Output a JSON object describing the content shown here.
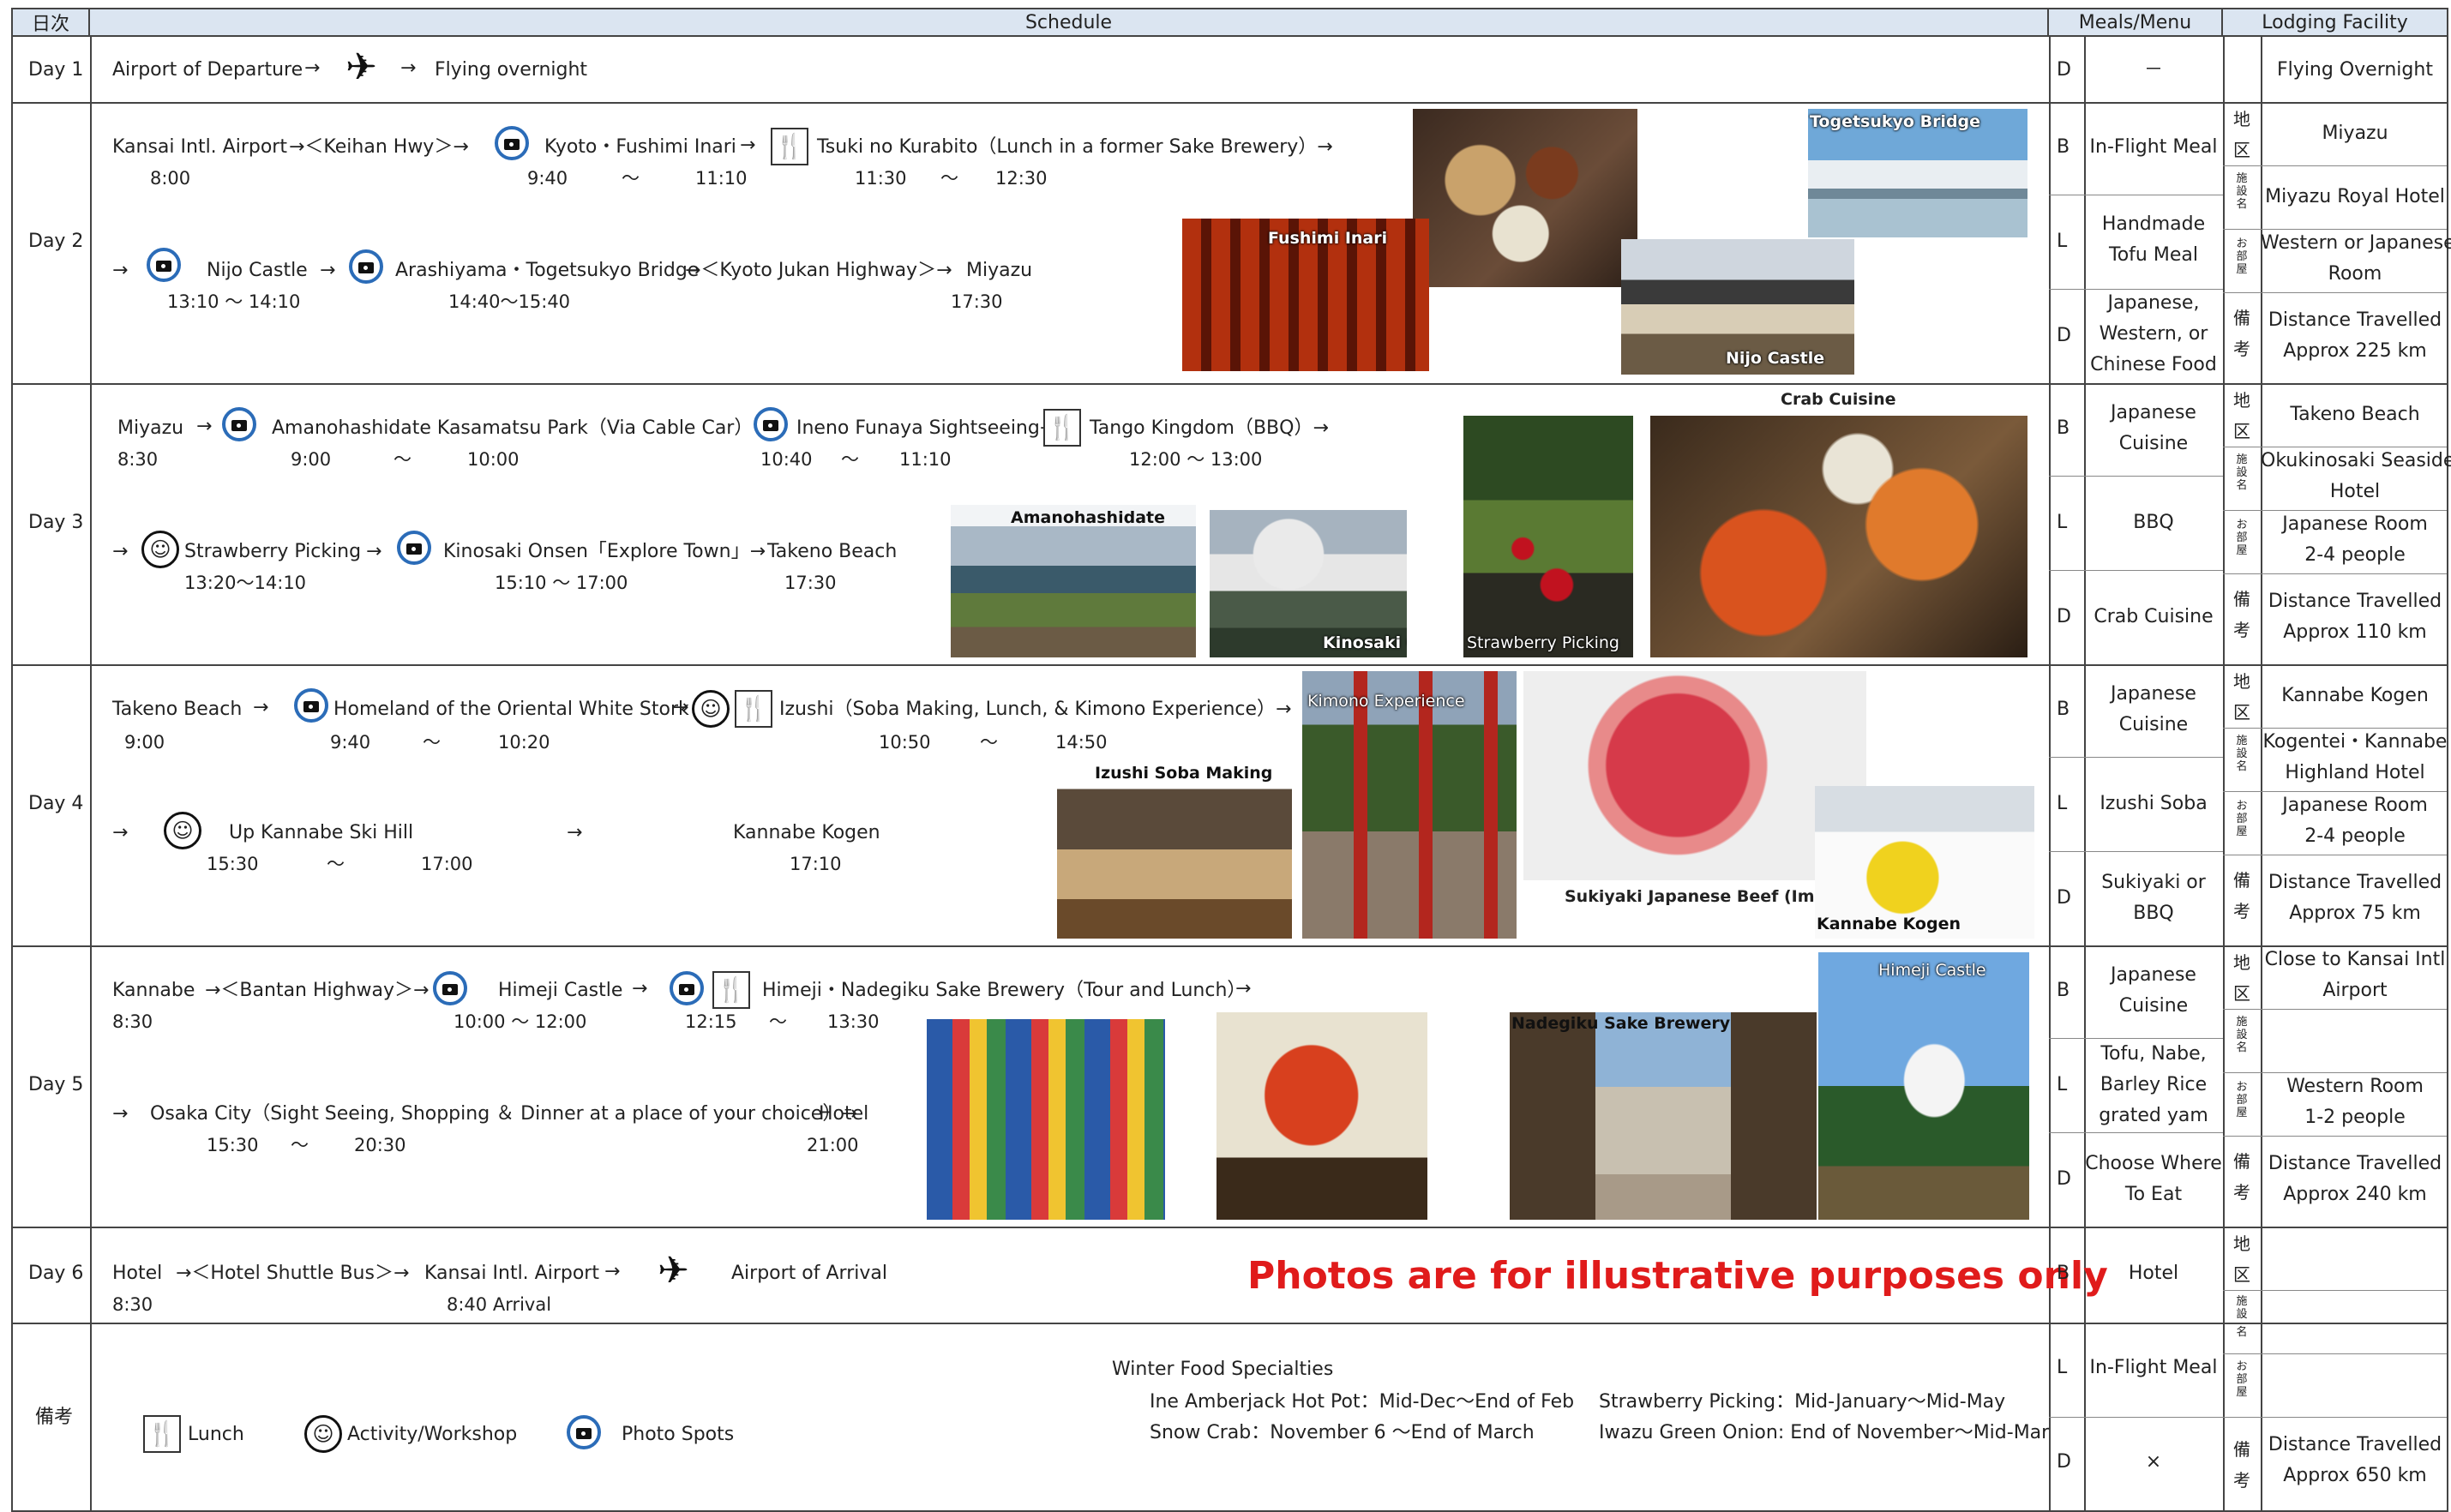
{
  "header": {
    "day": "日次",
    "schedule": "Schedule",
    "meals": "Meals/Menu",
    "lodging": "Lodging Facility"
  },
  "day1": {
    "label": "Day 1",
    "from": "Airport of Departure",
    "arrow1": "→",
    "arrow2": "→",
    "to": "Flying overnight",
    "meal_code": "D",
    "meal": "－",
    "lodging": "Flying Overnight"
  },
  "day2": {
    "label": "Day 2",
    "line1": {
      "a": "Kansai Intl. Airport",
      "b": "→＜Keihan Hwy＞→",
      "c": "Kyoto・Fushimi Inari",
      "d": "→",
      "e": "Tsuki no Kurabito（Lunch in a former Sake Brewery）→"
    },
    "times1": {
      "t1": "8:00",
      "t2": "9:40",
      "t3": "〜",
      "t4": "11:10",
      "t5": "11:30",
      "t6": "〜",
      "t7": "12:30"
    },
    "line2": {
      "a": "→",
      "b": "Nijo Castle",
      "c": "→",
      "d": "Arashiyama・Togetsukyo Bridge",
      "e": "→＜Kyoto Jukan Highway＞→",
      "f": "Miyazu"
    },
    "times2": {
      "t1": "13:10 〜 14:10",
      "t2": "14:40〜15:40",
      "t3": "17:30"
    },
    "photos": {
      "fushimi": "Fushimi Inari",
      "nijo": "Nijo Castle",
      "togetsukyo": "Togetsukyo Bridge"
    },
    "meals": [
      {
        "code": "B",
        "text": [
          "In-Flight Meal"
        ]
      },
      {
        "code": "L",
        "text": [
          "Handmade",
          "Tofu Meal"
        ]
      },
      {
        "code": "D",
        "text": [
          "Japanese,",
          "Western, or",
          "Chinese Food"
        ]
      }
    ],
    "lodging": {
      "area": "Miyazu",
      "facility": "Miyazu Royal Hotel",
      "room": [
        "Western or Japanese",
        "Room"
      ],
      "note": [
        "Distance Travelled",
        "Approx 225 km"
      ]
    }
  },
  "day3": {
    "label": "Day 3",
    "line1": {
      "a": "Miyazu",
      "b": "→",
      "c": "Amanohashidate Kasamatsu Park（Via Cable Car）→",
      "d": "Ineno Funaya Sightseeing→",
      "e": "Tango Kingdom（BBQ）→"
    },
    "times1": {
      "t1": "8:30",
      "t2": "9:00",
      "t3": "〜",
      "t4": "10:00",
      "t5": "10:40",
      "t6": "〜",
      "t7": "11:10",
      "t8": "12:00 〜 13:00"
    },
    "line2": {
      "a": "→",
      "b": "Strawberry Picking",
      "c": "→",
      "d": "Kinosaki Onsen「Explore Town」→",
      "e": "Takeno Beach"
    },
    "times2": {
      "t1": "13:20〜14:10",
      "t2": "15:10 〜 17:00",
      "t3": "17:30"
    },
    "photos": {
      "amano": "Amanohashidate",
      "kinosaki": "Kinosaki Onsen",
      "straw": "Strawberry Picking",
      "crab": "Crab Cuisine"
    },
    "meals": [
      {
        "code": "B",
        "text": [
          "Japanese",
          "Cuisine"
        ]
      },
      {
        "code": "L",
        "text": [
          "BBQ"
        ]
      },
      {
        "code": "D",
        "text": [
          "Crab Cuisine"
        ]
      }
    ],
    "lodging": {
      "area": "Takeno Beach",
      "facility": [
        "Okukinosaki Seaside",
        "Hotel"
      ],
      "room": [
        "Japanese Room",
        "2-4 people"
      ],
      "note": [
        "Distance Travelled",
        "Approx 110 km"
      ]
    }
  },
  "day4": {
    "label": "Day 4",
    "line1": {
      "a": "Takeno Beach",
      "b": "→",
      "c": "Homeland of the Oriental White Stork",
      "d": "→",
      "e": "Izushi（Soba Making, Lunch, & Kimono Experience）→"
    },
    "times1": {
      "t1": "9:00",
      "t2": "9:40",
      "t3": "〜",
      "t4": "10:20",
      "t5": "10:50",
      "t6": "〜",
      "t7": "14:50"
    },
    "line2": {
      "a": "→",
      "b": "Up Kannabe Ski Hill",
      "c": "→",
      "d": "Kannabe Kogen"
    },
    "times2": {
      "t1": "15:30",
      "t2": "〜",
      "t3": "17:00",
      "t4": "17:10"
    },
    "photos": {
      "soba": "Izushi Soba Making",
      "kimono": "Kimono Experience",
      "beef": "Sukiyaki Japanese Beef (Image)",
      "kannabe": "Kannabe Kogen"
    },
    "meals": [
      {
        "code": "B",
        "text": [
          "Japanese",
          "Cuisine"
        ]
      },
      {
        "code": "L",
        "text": [
          "Izushi Soba"
        ]
      },
      {
        "code": "D",
        "text": [
          "Sukiyaki or",
          "BBQ"
        ]
      }
    ],
    "lodging": {
      "area": "Kannabe Kogen",
      "facility": [
        "Kogentei・Kannabe",
        "Highland Hotel"
      ],
      "room": [
        "Japanese Room",
        "2-4 people"
      ],
      "note": [
        "Distance Travelled",
        "Approx 75 km"
      ]
    }
  },
  "day5": {
    "label": "Day 5",
    "line1": {
      "a": "Kannabe",
      "b": "→＜Bantan Highway＞→",
      "c": "Himeji Castle",
      "d": "→",
      "e": "Himeji・Nadegiku Sake Brewery（Tour and Lunch）",
      "f": "→"
    },
    "times1": {
      "t1": "8:30",
      "t2": "10:00 〜 12:00",
      "t3": "12:15",
      "t4": "〜",
      "t5": "13:30"
    },
    "line2": {
      "a": "→",
      "b": "Osaka City（Sight Seeing, Shopping ＆ Dinner at a place of your choice）→",
      "c": "Hotel"
    },
    "times2": {
      "t1": "15:30",
      "t2": "〜",
      "t3": "20:30",
      "t4": "21:00"
    },
    "photos": {
      "nadegiku": "Nadegiku Sake Brewery",
      "himeji": "Himeji Castle"
    },
    "meals": [
      {
        "code": "B",
        "text": [
          "Japanese",
          "Cuisine"
        ]
      },
      {
        "code": "L",
        "text": [
          "Tofu, Nabe,",
          "Barley Rice",
          "grated yam"
        ]
      },
      {
        "code": "D",
        "text": [
          "Choose Where",
          "To Eat"
        ]
      }
    ],
    "lodging": {
      "area": [
        "Close to Kansai Intl",
        "Airport"
      ],
      "facility": "",
      "room": [
        "Western Room",
        "1-2 people"
      ],
      "note": [
        "Distance Travelled",
        "Approx 240 km"
      ]
    }
  },
  "day6": {
    "label": "Day 6",
    "line1": {
      "a": "Hotel",
      "b": "→＜Hotel Shuttle Bus＞→",
      "c": "Kansai Intl. Airport",
      "d": "→",
      "e": "Airport of Arrival"
    },
    "times1": {
      "t1": "8:30",
      "t2": "8:40 Arrival"
    },
    "note": "Photos are for illustrative purposes only",
    "meals": [
      {
        "code": "B",
        "text": [
          "Hotel"
        ]
      },
      {
        "code": "L",
        "text": [
          "In-Flight Meal"
        ]
      },
      {
        "code": "D",
        "text": [
          "×"
        ]
      }
    ],
    "lodging": {
      "note": [
        "Distance Travelled",
        "Approx 650 km"
      ]
    }
  },
  "remarks": {
    "label": "備考",
    "legend": {
      "lunch": "Lunch",
      "activity": "Activity/Workshop",
      "photo": "Photo Spots"
    },
    "winter_title": "Winter Food Specialties",
    "w1": "Ine Amberjack Hot Pot：Mid-Dec〜End of Feb",
    "w2": "Snow Crab：November 6 〜End of March",
    "w3": "Strawberry Picking：Mid-January〜Mid-May",
    "w4": "Iwazu Green Onion: End of November〜Mid-Mar"
  },
  "kanji": {
    "area": [
      "地",
      "区"
    ],
    "facility": [
      "施",
      "設",
      "名"
    ],
    "room": [
      "お",
      "部",
      "屋"
    ],
    "note": [
      "備",
      "考"
    ]
  },
  "icons": {
    "camera": "camera-icon",
    "fork": "fork-knife-icon",
    "smile": "smiley-icon",
    "plane": "airplane-icon"
  },
  "colors": {
    "header_bg": "#dbe5f1",
    "camera_ring": "#2b6cb8",
    "note_red": "#e01b1b"
  }
}
